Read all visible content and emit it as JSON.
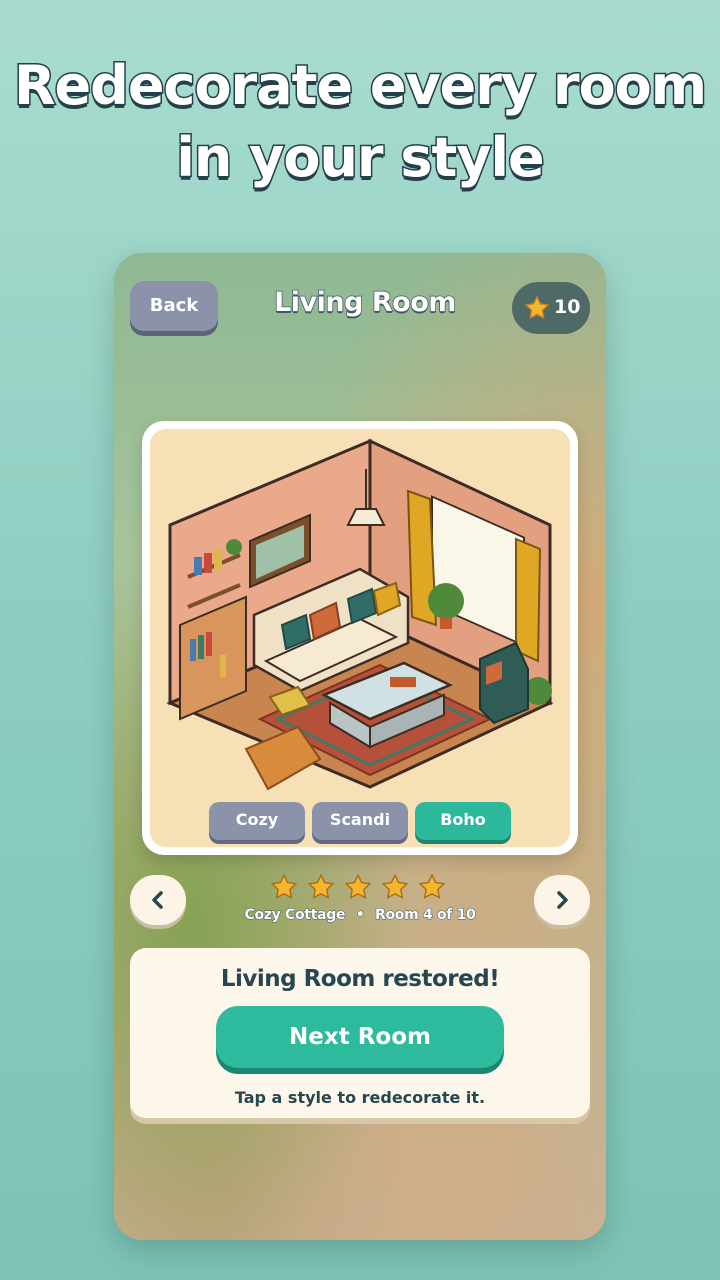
{
  "headline": {
    "line1": "Redecorate every room",
    "line2": "in your style"
  },
  "header": {
    "back_label": "Back",
    "title": "Living Room",
    "star_count": "10"
  },
  "styles": [
    {
      "label": "Cozy",
      "selected": false
    },
    {
      "label": "Scandi",
      "selected": false
    },
    {
      "label": "Boho",
      "selected": true
    }
  ],
  "rating": {
    "stars": 5,
    "max": 5
  },
  "room_info": {
    "collection": "Cozy Cottage",
    "separator": "•",
    "progress": "Room 4 of 10"
  },
  "panel": {
    "message": "Living Room restored!",
    "next_label": "Next Room",
    "hint": "Tap a style to redecorate it."
  },
  "icons": {
    "star": "star-icon",
    "prev": "chevron-left-icon",
    "next": "chevron-right-icon"
  },
  "colors": {
    "accent": "#2ebb9d",
    "button_gray": "#8b93aa",
    "star": "#f5b531",
    "text_dark": "#264650"
  }
}
